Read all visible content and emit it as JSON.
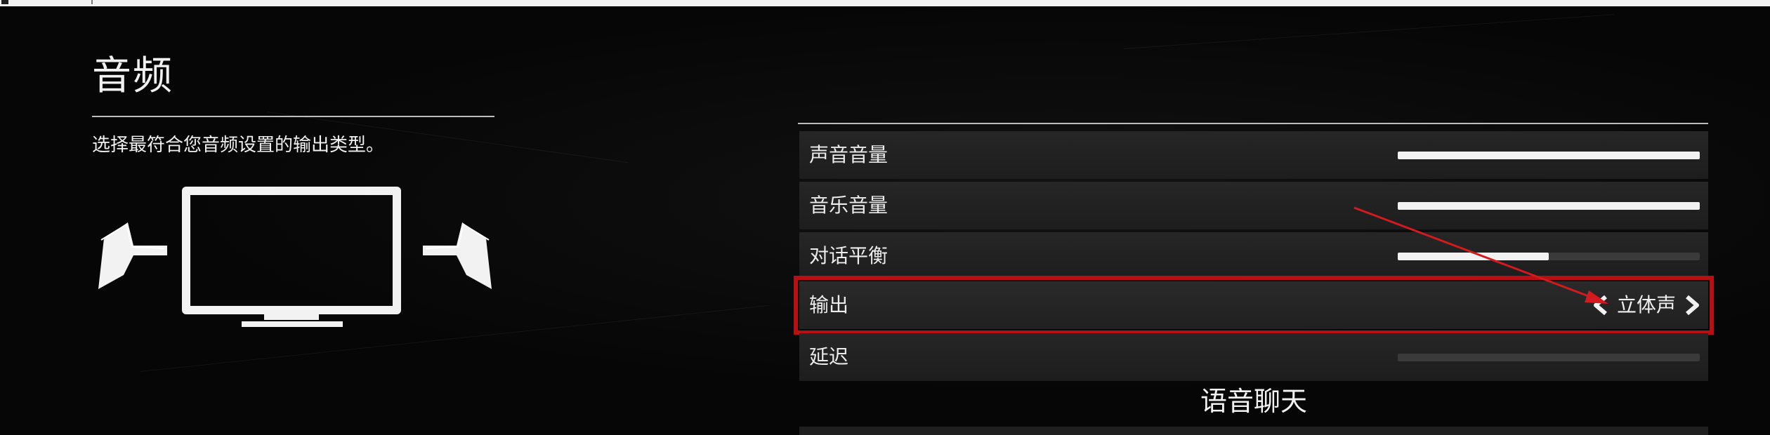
{
  "page": {
    "title": "音频",
    "description": "选择最符合您音频设置的输出类型。"
  },
  "illustration": {
    "icons": [
      "speaker-left-icon",
      "monitor-icon",
      "speaker-right-icon"
    ]
  },
  "settings": [
    {
      "label": "声音音量",
      "type": "slider",
      "value_fraction": 1.0
    },
    {
      "label": "音乐音量",
      "type": "slider",
      "value_fraction": 1.0
    },
    {
      "label": "对话平衡",
      "type": "slider",
      "value_fraction": 0.5
    },
    {
      "label": "输出",
      "type": "selector",
      "value": "立体声",
      "selected": true
    },
    {
      "label": "延迟",
      "type": "slider",
      "value_fraction": 0.0
    }
  ],
  "voice_chat": {
    "heading": "语音聊天"
  },
  "colors": {
    "background": "#060606",
    "row": "#242424",
    "highlight": "#b80f14",
    "slider_fill": "#f2f2f2",
    "text": "#ececec"
  }
}
